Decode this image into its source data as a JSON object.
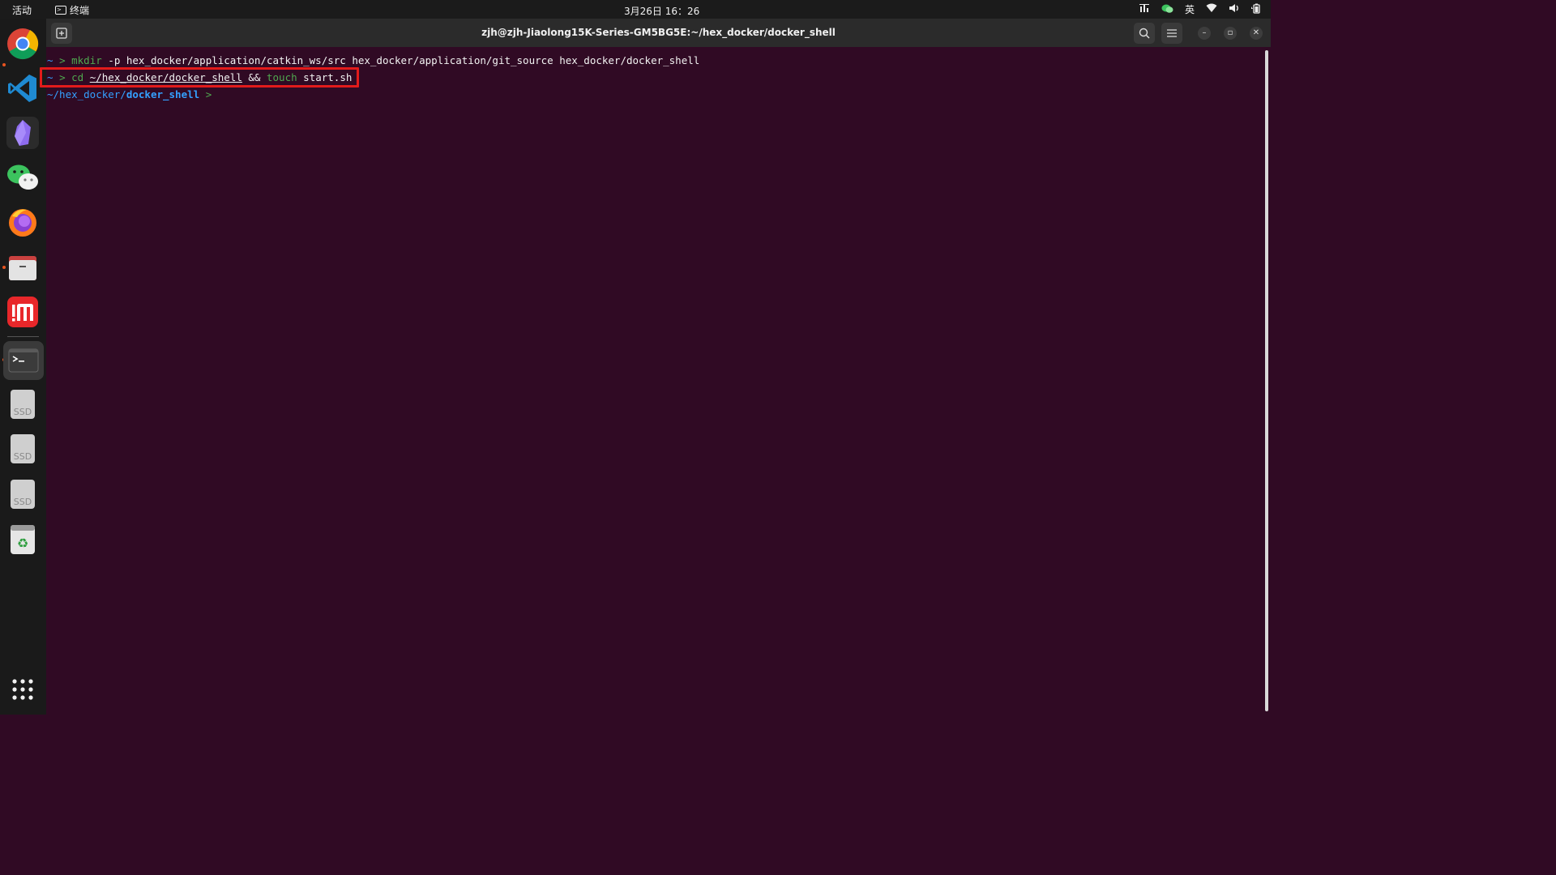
{
  "topbar": {
    "activities": "活动",
    "app_name": "终端",
    "clock": "3月26日 16：26",
    "input_method": "英"
  },
  "dock": {
    "items": [
      "chrome",
      "vscode",
      "obsidian",
      "wechat",
      "firefox",
      "files",
      "app-store",
      "terminal",
      "ssd-1",
      "ssd-2",
      "ssd-3",
      "trash",
      "show-apps"
    ],
    "ssd_label": "SSD"
  },
  "window": {
    "title": "zjh@zjh-Jiaolong15K-Series-GM5BG5E:~/hex_docker/docker_shell"
  },
  "terminal": {
    "line1": {
      "prompt": "~",
      "arrow": ">",
      "cmd": "mkdir",
      "args": "-p hex_docker/application/catkin_ws/src hex_docker/application/git_source hex_docker/docker_shell"
    },
    "line2": {
      "prompt": "~",
      "arrow": ">",
      "cmd": "cd",
      "path": "~/hex_docker/docker_shell",
      "op": "&&",
      "cmd2": "touch",
      "arg2": "start.sh"
    },
    "line3": {
      "path_dim": "~/hex_docker/",
      "path_bold": "docker_shell",
      "arrow": ">"
    }
  },
  "colors": {
    "terminal_bg": "#300a24",
    "highlight_box": "#e21b1b",
    "prompt_blue": "#34a0ff",
    "command_green": "#4fa84f"
  }
}
